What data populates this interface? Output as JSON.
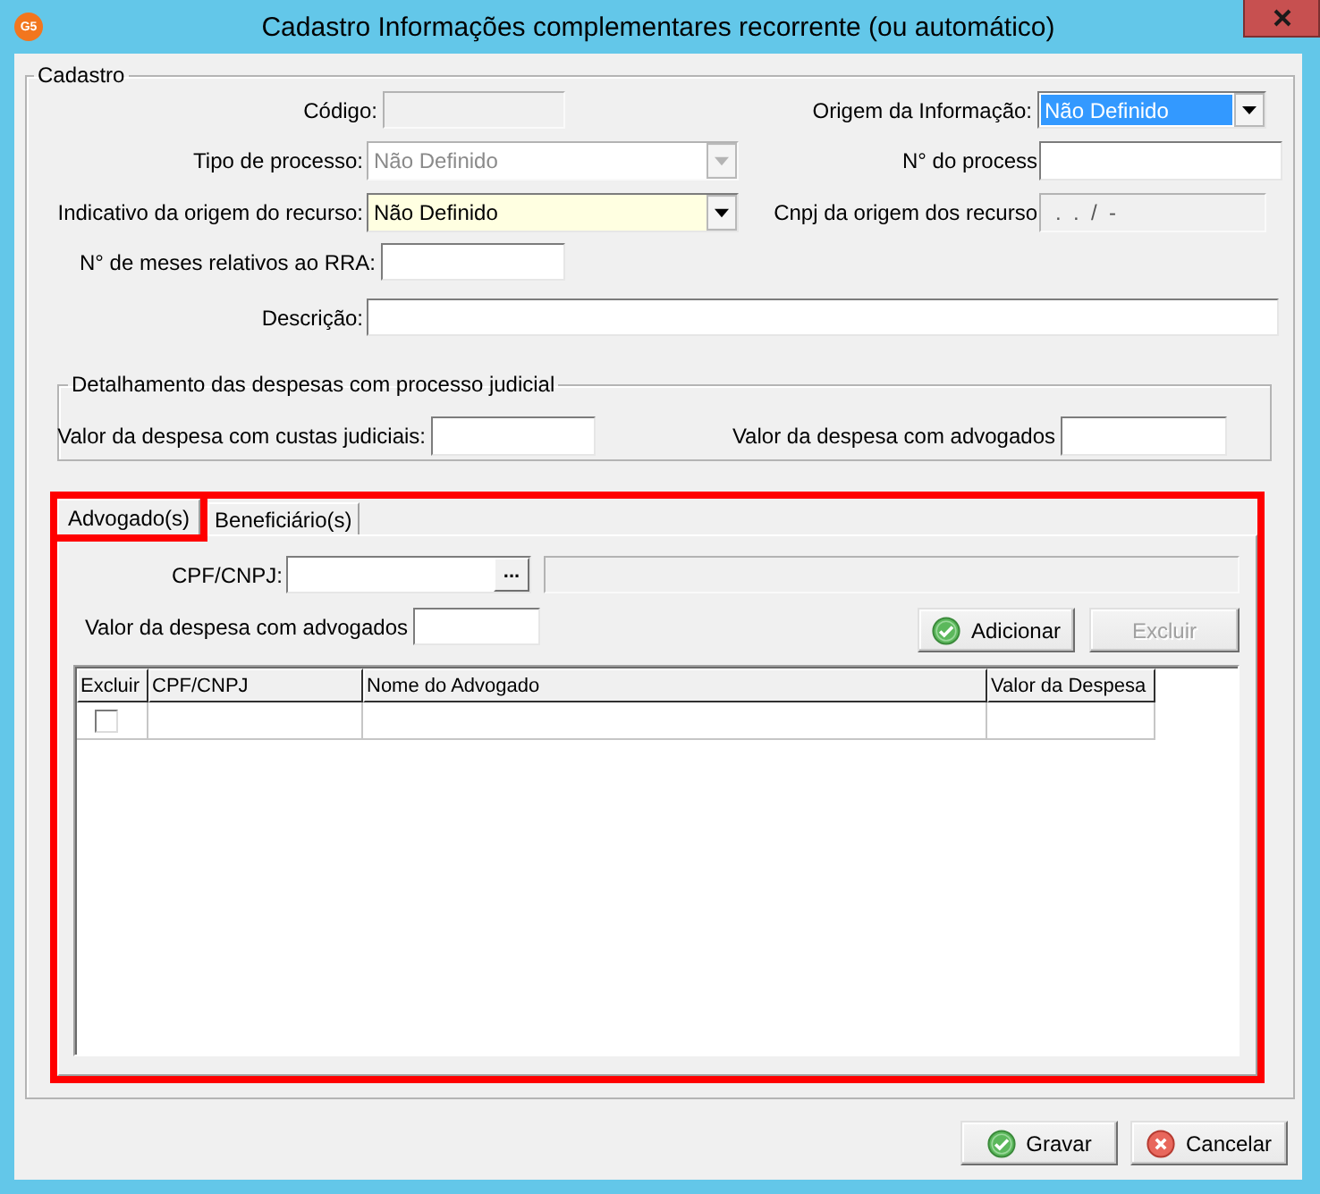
{
  "window": {
    "icon_text": "G5",
    "title": "Cadastro Informações complementares recorrente (ou automático)"
  },
  "cadastro": {
    "legend": "Cadastro",
    "rows": [
      {
        "fields": [
          {
            "kind": "text",
            "label": "Código:",
            "disabled": true
          },
          {
            "kind": "select",
            "label": "Origem da Informação:",
            "value": "Não Definido",
            "disabled": false,
            "required": false,
            "text_selected": true
          }
        ]
      },
      {
        "fields": [
          {
            "kind": "select",
            "label": "Tipo de processo:",
            "value": "Não Definido",
            "disabled": true,
            "required": false,
            "text_selected": false
          },
          {
            "kind": "text",
            "label": "N° do process",
            "disabled": false
          }
        ]
      },
      {
        "fields": [
          {
            "kind": "select",
            "label": "Indicativo da origem do recurso:",
            "value": "Não Definido",
            "disabled": false,
            "required": true,
            "text_selected": false
          },
          {
            "kind": "text",
            "label": "Cnpj da origem dos recurso",
            "value": ".  .  /  -",
            "disabled": true
          }
        ]
      },
      {
        "fields": [
          {
            "kind": "text",
            "label": "N° de meses relativos ao RRA:",
            "disabled": false
          }
        ]
      },
      {
        "fields": [
          {
            "kind": "text",
            "label": "Descrição:",
            "disabled": false
          }
        ]
      }
    ],
    "detalhamento": {
      "legend": "Detalhamento das despesas com processo judicial",
      "fields": [
        {
          "kind": "text",
          "label": "Valor da despesa com custas judiciais:",
          "disabled": false
        },
        {
          "kind": "text",
          "label": "Valor da despesa com advogados",
          "disabled": false
        }
      ]
    },
    "tabs_section": {
      "annotated": true,
      "tabs": [
        {
          "label": "Advogado(s)",
          "selected": true,
          "annotated": true
        },
        {
          "label": "Beneficiário(s)",
          "selected": false,
          "annotated": false
        }
      ],
      "panel": {
        "cpf_cnpj": {
          "label": "CPF/CNPJ:",
          "lookup_button": "...",
          "disabled": false
        },
        "name_field": {
          "disabled": true
        },
        "valor_despesa": {
          "label": "Valor da despesa com advogados",
          "disabled": false
        },
        "buttons": [
          {
            "label": "Adicionar",
            "kind": "confirm",
            "disabled": false
          },
          {
            "label": "Excluir",
            "kind": "plain",
            "disabled": true
          }
        ],
        "grid": {
          "columns": [
            {
              "label": "Excluir"
            },
            {
              "label": "CPF/CNPJ"
            },
            {
              "label": "Nome do Advogado"
            },
            {
              "label": "Valor da Despesa"
            }
          ],
          "rows": [
            {
              "checked": false
            }
          ]
        }
      }
    }
  },
  "footer_buttons": [
    {
      "label": "Gravar",
      "kind": "confirm",
      "disabled": false
    },
    {
      "label": "Cancelar",
      "kind": "cancel",
      "disabled": false
    }
  ]
}
